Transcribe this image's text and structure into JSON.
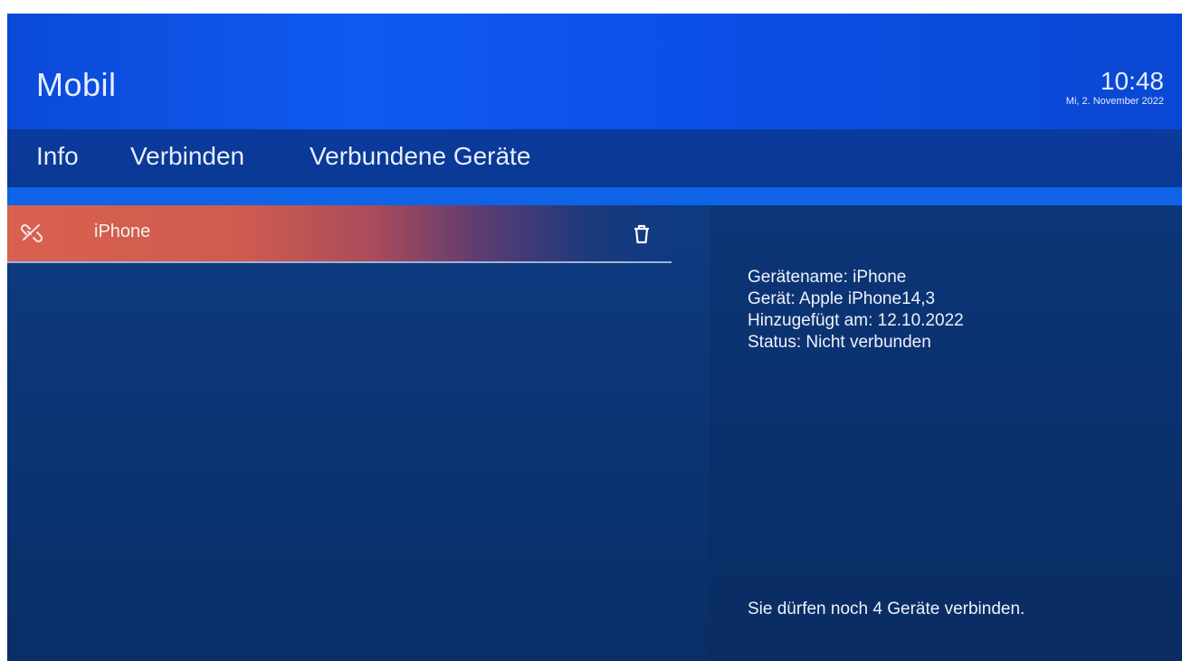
{
  "header": {
    "title": "Mobil",
    "time": "10:48",
    "date": "Mi, 2. November 2022"
  },
  "tabs": [
    {
      "label": "Info"
    },
    {
      "label": "Verbinden"
    },
    {
      "label": "Verbundene Geräte"
    }
  ],
  "devices": [
    {
      "name": "iPhone",
      "status_icon": "unlink-icon",
      "action_icon": "trash-icon"
    }
  ],
  "details": {
    "device_name": "Gerätename: iPhone",
    "device_model": "Gerät: Apple iPhone14,3",
    "added_on": "Hinzugefügt am: 12.10.2022",
    "status": "Status: Nicht verbunden"
  },
  "footer_note": "Sie dürfen noch 4 Geräte verbinden.",
  "colors": {
    "header_blue": "#0f5af0",
    "selection_red": "#d9614e",
    "panel_navy": "#0a2f6a"
  }
}
